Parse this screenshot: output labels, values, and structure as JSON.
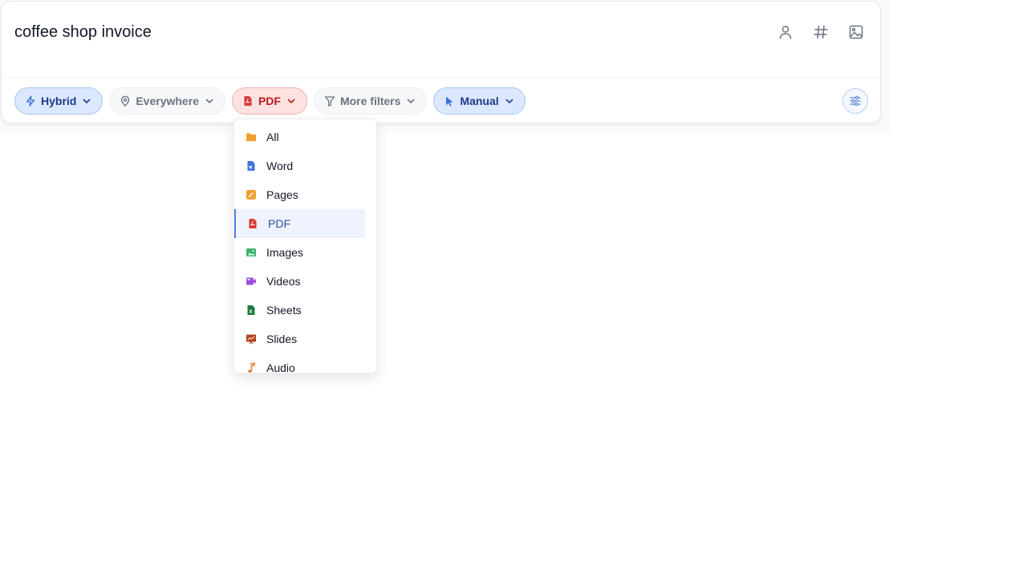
{
  "search": {
    "query": "coffee shop invoice"
  },
  "header_icons": [
    "person-icon",
    "hashtag-icon",
    "image-icon"
  ],
  "filters": {
    "mode": "Hybrid",
    "location": "Everywhere",
    "file_type": "PDF",
    "more": "More filters",
    "selection": "Manual"
  },
  "file_type_menu": {
    "selected": "PDF",
    "items": [
      {
        "label": "All",
        "icon": "folder-icon",
        "color": "#f0a030"
      },
      {
        "label": "Word",
        "icon": "word-doc-icon",
        "color": "#3b73e0"
      },
      {
        "label": "Pages",
        "icon": "pages-doc-icon",
        "color": "#f0a030"
      },
      {
        "label": "PDF",
        "icon": "pdf-icon",
        "color": "#d93a3a"
      },
      {
        "label": "Images",
        "icon": "image-icon",
        "color": "#3bb26b"
      },
      {
        "label": "Videos",
        "icon": "video-icon",
        "color": "#9b4de0"
      },
      {
        "label": "Sheets",
        "icon": "spreadsheet-icon",
        "color": "#1f7a3a"
      },
      {
        "label": "Slides",
        "icon": "presentation-icon",
        "color": "#b4421e"
      },
      {
        "label": "Audio",
        "icon": "music-note-icon",
        "color": "#f0782a"
      }
    ]
  },
  "colors": {
    "accent_blue": "#dbe8fd",
    "pdf_red": "#fde2e1",
    "selected_item_bg": "#eef3fd"
  }
}
